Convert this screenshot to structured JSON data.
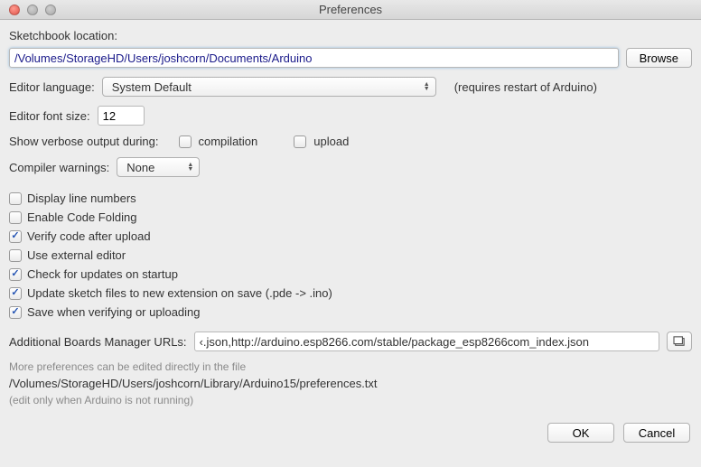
{
  "window": {
    "title": "Preferences"
  },
  "sketchbook": {
    "label": "Sketchbook location:",
    "path": "/Volumes/StorageHD/Users/joshcorn/Documents/Arduino",
    "browse": "Browse"
  },
  "editor_language": {
    "label": "Editor language:",
    "value": "System Default",
    "note": "(requires restart of Arduino)"
  },
  "editor_font_size": {
    "label": "Editor font size:",
    "value": "12"
  },
  "verbose": {
    "label": "Show verbose output during:",
    "compilation_label": "compilation",
    "compilation_checked": false,
    "upload_label": "upload",
    "upload_checked": false
  },
  "compiler_warnings": {
    "label": "Compiler warnings:",
    "value": "None"
  },
  "checkboxes": [
    {
      "label": "Display line numbers",
      "checked": false
    },
    {
      "label": "Enable Code Folding",
      "checked": false
    },
    {
      "label": "Verify code after upload",
      "checked": true
    },
    {
      "label": "Use external editor",
      "checked": false
    },
    {
      "label": "Check for updates on startup",
      "checked": true
    },
    {
      "label": "Update sketch files to new extension on save (.pde -> .ino)",
      "checked": true
    },
    {
      "label": "Save when verifying or uploading",
      "checked": true
    }
  ],
  "boards_urls": {
    "label": "Additional Boards Manager URLs:",
    "value": "‹.json,http://arduino.esp8266.com/stable/package_esp8266com_index.json"
  },
  "footer": {
    "line1": "More preferences can be edited directly in the file",
    "line2": "/Volumes/StorageHD/Users/joshcorn/Library/Arduino15/preferences.txt",
    "line3": "(edit only when Arduino is not running)"
  },
  "buttons": {
    "ok": "OK",
    "cancel": "Cancel"
  }
}
